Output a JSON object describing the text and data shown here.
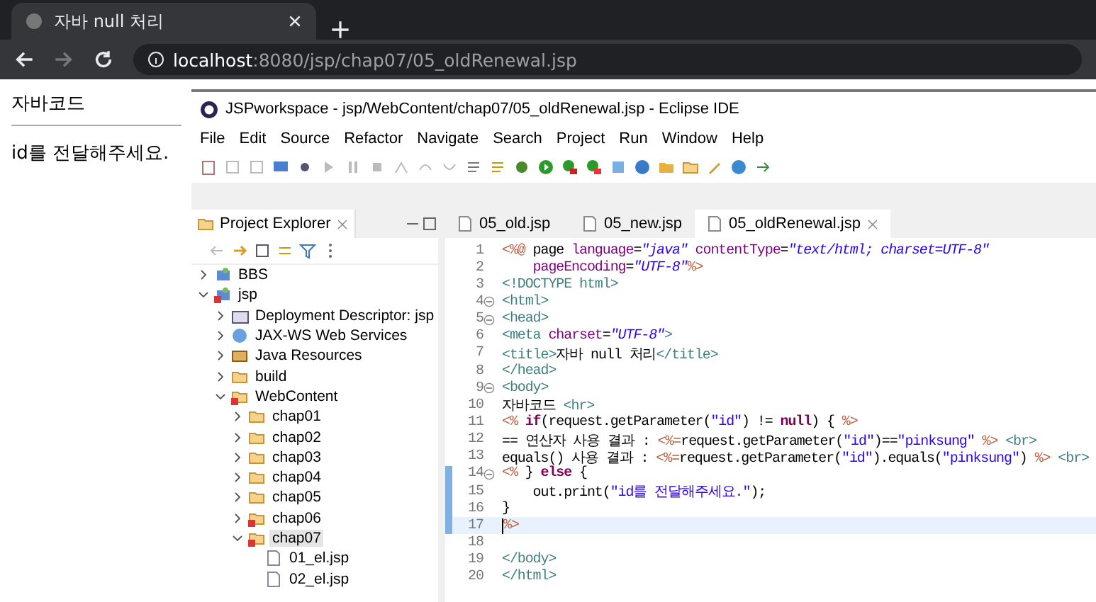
{
  "browser": {
    "tab": {
      "title": "자바 null 처리"
    },
    "url_host": "localhost",
    "url_rest": ":8080/jsp/chap07/05_oldRenewal.jsp"
  },
  "page": {
    "heading": "자바코드",
    "message": "id를 전달해주세요."
  },
  "eclipse": {
    "title": "JSPworkspace - jsp/WebContent/chap07/05_oldRenewal.jsp - Eclipse IDE",
    "menu": [
      "File",
      "Edit",
      "Source",
      "Refactor",
      "Navigate",
      "Search",
      "Project",
      "Run",
      "Window",
      "Help"
    ],
    "explorer": {
      "title": "Project Explorer",
      "tree": [
        {
          "label": "BBS",
          "kind": "project",
          "expanded": false,
          "error": false,
          "selected": false
        },
        {
          "label": "jsp",
          "kind": "project",
          "expanded": true,
          "error": true,
          "selected": false,
          "children": [
            {
              "label": "Deployment Descriptor: jsp",
              "kind": "descriptor",
              "expanded": false,
              "error": false,
              "selected": false
            },
            {
              "label": "JAX-WS Web Services",
              "kind": "services",
              "expanded": false,
              "error": false,
              "selected": false
            },
            {
              "label": "Java Resources",
              "kind": "resources",
              "expanded": false,
              "error": false,
              "selected": false
            },
            {
              "label": "build",
              "kind": "folder",
              "expanded": false,
              "error": false,
              "selected": false
            },
            {
              "label": "WebContent",
              "kind": "folder",
              "expanded": true,
              "error": true,
              "selected": false,
              "children": [
                {
                  "label": "chap01",
                  "kind": "folder",
                  "expanded": false,
                  "error": false,
                  "selected": false
                },
                {
                  "label": "chap02",
                  "kind": "folder",
                  "expanded": false,
                  "error": false,
                  "selected": false
                },
                {
                  "label": "chap03",
                  "kind": "folder",
                  "expanded": false,
                  "error": false,
                  "selected": false
                },
                {
                  "label": "chap04",
                  "kind": "folder",
                  "expanded": false,
                  "error": false,
                  "selected": false
                },
                {
                  "label": "chap05",
                  "kind": "folder",
                  "expanded": false,
                  "error": false,
                  "selected": false
                },
                {
                  "label": "chap06",
                  "kind": "folder",
                  "expanded": false,
                  "error": true,
                  "selected": false
                },
                {
                  "label": "chap07",
                  "kind": "folder",
                  "expanded": true,
                  "error": true,
                  "selected": true,
                  "children": [
                    {
                      "label": "01_el.jsp",
                      "kind": "file",
                      "error": false,
                      "selected": false
                    },
                    {
                      "label": "02_el.jsp",
                      "kind": "file",
                      "error": false,
                      "selected": false
                    }
                  ]
                }
              ]
            }
          ]
        }
      ]
    },
    "tabs": [
      {
        "label": "05_old.jsp",
        "selected": false
      },
      {
        "label": "05_new.jsp",
        "selected": false
      },
      {
        "label": "05_oldRenewal.jsp",
        "selected": true
      }
    ],
    "lines": [
      {
        "number": "1",
        "fold": false,
        "changed": false,
        "current": false,
        "tokens": [
          {
            "kind": "jsp",
            "text": "<%@"
          },
          {
            "kind": "text",
            "text": " page "
          },
          {
            "kind": "attr",
            "text": "language"
          },
          {
            "kind": "text",
            "text": "="
          },
          {
            "kind": "value",
            "text": "\"java\""
          },
          {
            "kind": "attr",
            "text": " contentType"
          },
          {
            "kind": "text",
            "text": "="
          },
          {
            "kind": "value",
            "text": "\"text/html; charset=UTF-8\""
          }
        ]
      },
      {
        "number": "2",
        "fold": false,
        "changed": false,
        "current": false,
        "tokens": [
          {
            "kind": "attr",
            "text": "    pageEncoding"
          },
          {
            "kind": "text",
            "text": "="
          },
          {
            "kind": "value",
            "text": "\"UTF-8\""
          },
          {
            "kind": "jsp",
            "text": "%>"
          }
        ]
      },
      {
        "number": "3",
        "fold": false,
        "changed": false,
        "current": false,
        "tokens": [
          {
            "kind": "tag",
            "text": "<!DOCTYPE html>"
          }
        ]
      },
      {
        "number": "4",
        "fold": true,
        "changed": false,
        "current": false,
        "tokens": [
          {
            "kind": "tag",
            "text": "<html>"
          }
        ]
      },
      {
        "number": "5",
        "fold": true,
        "changed": false,
        "current": false,
        "tokens": [
          {
            "kind": "tag",
            "text": "<head>"
          }
        ]
      },
      {
        "number": "6",
        "fold": false,
        "changed": false,
        "current": false,
        "tokens": [
          {
            "kind": "tag",
            "text": "<meta "
          },
          {
            "kind": "attr",
            "text": "charset"
          },
          {
            "kind": "text",
            "text": "="
          },
          {
            "kind": "value",
            "text": "\"UTF-8\""
          },
          {
            "kind": "tag",
            "text": ">"
          }
        ]
      },
      {
        "number": "7",
        "fold": false,
        "changed": false,
        "current": false,
        "tokens": [
          {
            "kind": "tag",
            "text": "<title>"
          },
          {
            "kind": "text",
            "text": "자바 null 처리"
          },
          {
            "kind": "tag",
            "text": "</title>"
          }
        ]
      },
      {
        "number": "8",
        "fold": false,
        "changed": false,
        "current": false,
        "tokens": [
          {
            "kind": "tag",
            "text": "</head>"
          }
        ]
      },
      {
        "number": "9",
        "fold": true,
        "changed": false,
        "current": false,
        "tokens": [
          {
            "kind": "tag",
            "text": "<body>"
          }
        ]
      },
      {
        "number": "10",
        "fold": false,
        "changed": false,
        "current": false,
        "tokens": [
          {
            "kind": "text",
            "text": "자바코드 "
          },
          {
            "kind": "tag",
            "text": "<hr>"
          }
        ]
      },
      {
        "number": "11",
        "fold": false,
        "changed": false,
        "current": false,
        "tokens": [
          {
            "kind": "jsp",
            "text": "<%"
          },
          {
            "kind": "keyword",
            "text": " if"
          },
          {
            "kind": "text",
            "text": "(request.getParameter("
          },
          {
            "kind": "string",
            "text": "\"id\""
          },
          {
            "kind": "text",
            "text": ") != "
          },
          {
            "kind": "keyword",
            "text": "null"
          },
          {
            "kind": "text",
            "text": ") { "
          },
          {
            "kind": "jsp",
            "text": "%>"
          }
        ]
      },
      {
        "number": "12",
        "fold": false,
        "changed": false,
        "current": false,
        "tokens": [
          {
            "kind": "text",
            "text": "== 연산자 사용 결과 : "
          },
          {
            "kind": "jsp",
            "text": "<%="
          },
          {
            "kind": "text",
            "text": "request.getParameter("
          },
          {
            "kind": "string",
            "text": "\"id\""
          },
          {
            "kind": "text",
            "text": ")=="
          },
          {
            "kind": "string",
            "text": "\"pinksung\""
          },
          {
            "kind": "jsp",
            "text": " %>"
          },
          {
            "kind": "tag",
            "text": " <br>"
          }
        ]
      },
      {
        "number": "13",
        "fold": false,
        "changed": false,
        "current": false,
        "tokens": [
          {
            "kind": "text",
            "text": "equals() 사용 결과 : "
          },
          {
            "kind": "jsp",
            "text": "<%="
          },
          {
            "kind": "text",
            "text": "request.getParameter("
          },
          {
            "kind": "string",
            "text": "\"id\""
          },
          {
            "kind": "text",
            "text": ").equals("
          },
          {
            "kind": "string",
            "text": "\"pinksung\""
          },
          {
            "kind": "text",
            "text": ") "
          },
          {
            "kind": "jsp",
            "text": "%>"
          },
          {
            "kind": "tag",
            "text": " <br>"
          }
        ]
      },
      {
        "number": "14",
        "fold": true,
        "changed": true,
        "current": false,
        "tokens": [
          {
            "kind": "jsp",
            "text": "<%"
          },
          {
            "kind": "text",
            "text": " } "
          },
          {
            "kind": "keyword",
            "text": "else"
          },
          {
            "kind": "text",
            "text": " {"
          }
        ]
      },
      {
        "number": "15",
        "fold": false,
        "changed": true,
        "current": false,
        "tokens": [
          {
            "kind": "text",
            "text": "    out.print("
          },
          {
            "kind": "string",
            "text": "\"id를 전달해주세요.\""
          },
          {
            "kind": "text",
            "text": ");"
          }
        ]
      },
      {
        "number": "16",
        "fold": false,
        "changed": true,
        "current": false,
        "tokens": [
          {
            "kind": "text",
            "text": "}"
          }
        ]
      },
      {
        "number": "17",
        "fold": false,
        "changed": true,
        "current": true,
        "tokens": [
          {
            "kind": "jsp",
            "text": "%>"
          }
        ]
      },
      {
        "number": "18",
        "fold": false,
        "changed": false,
        "current": false
      },
      {
        "number": "19",
        "fold": false,
        "changed": false,
        "current": false,
        "tokens": [
          {
            "kind": "tag",
            "text": "</body>"
          }
        ]
      },
      {
        "number": "20",
        "fold": false,
        "changed": false,
        "current": false,
        "tokens": [
          {
            "kind": "tag",
            "text": "</html>"
          }
        ]
      }
    ]
  }
}
